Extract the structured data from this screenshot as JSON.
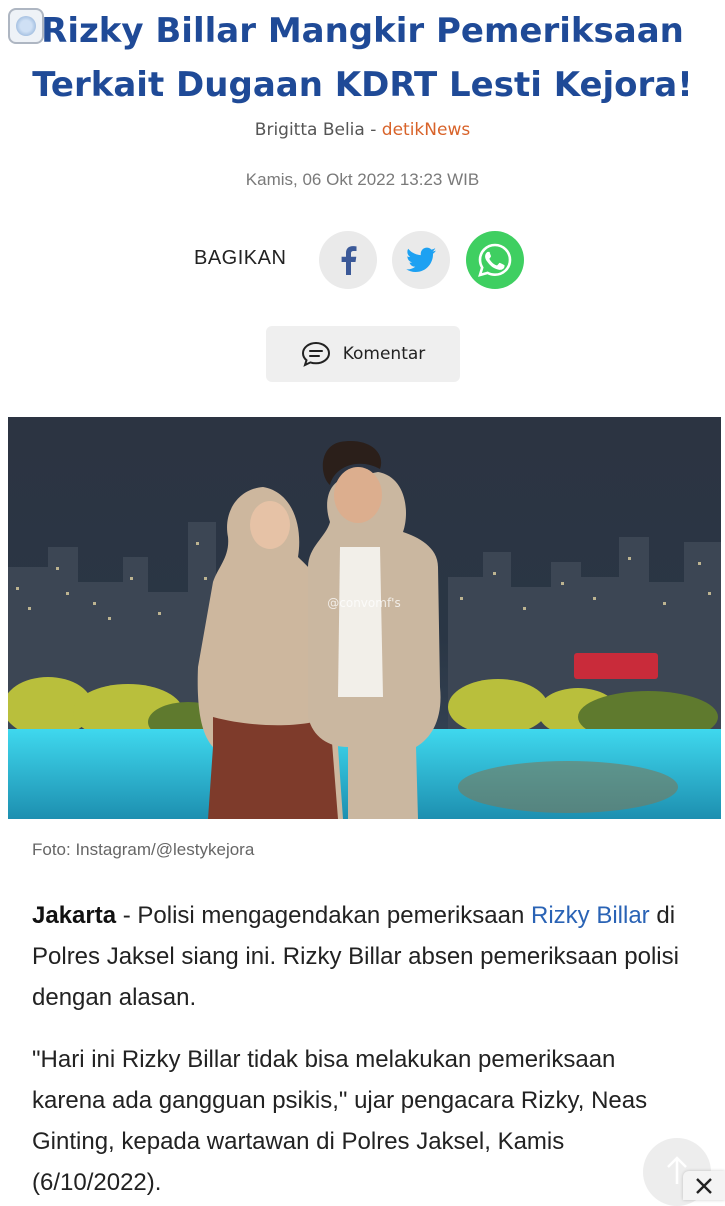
{
  "article": {
    "title": "Rizky Billar Mangkir Pemeriksaan Terkait Dugaan KDRT Lesti Kejora!",
    "author": "Brigitta Belia",
    "separator": " - ",
    "source": "detikNews",
    "date": "Kamis, 06 Okt 2022 13:23 WIB"
  },
  "share": {
    "label": "BAGIKAN",
    "buttons": [
      {
        "name": "facebook-icon"
      },
      {
        "name": "twitter-icon"
      },
      {
        "name": "whatsapp-icon"
      }
    ]
  },
  "comment": {
    "label": "Komentar",
    "icon": "speech-bubble-icon"
  },
  "photo": {
    "watermark": "@convomf's",
    "caption": "Foto: Instagram/@lestykejora"
  },
  "body": {
    "p1_location": "Jakarta",
    "p1_dash": " - Polisi mengagendakan pemeriksaan ",
    "p1_link": "Rizky Billar",
    "p1_rest": " di Polres Jaksel siang ini. Rizky Billar absen pemeriksaan polisi dengan alasan.",
    "p2": "\"Hari ini Rizky Billar tidak bisa melakukan pemeriksaan karena ada gangguan psikis,\" ujar pengacara Rizky, Neas Ginting, kepada wartawan di Polres Jaksel, Kamis (6/10/2022)."
  },
  "colors": {
    "title": "#1f4a97",
    "source": "#d8632a",
    "link": "#2a63b5",
    "whatsapp": "#3fcf61",
    "facebook": "#3b5998",
    "twitter": "#1da1f2"
  }
}
